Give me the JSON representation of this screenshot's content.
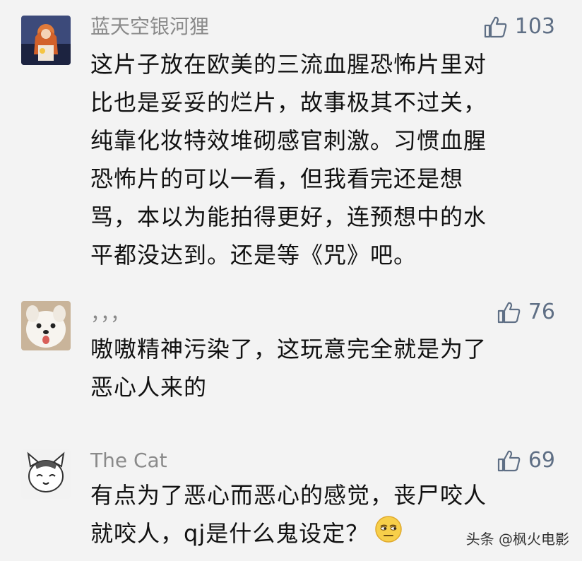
{
  "comments": [
    {
      "username": "蓝天空银河狸",
      "likes": "103",
      "lines": [
        "这片子放在欧美的三流血腥恐怖片里对",
        "比也是妥妥的烂片，故事极其不过关，",
        "纯靠化妆特效堆砌感官刺激。习惯血腥",
        "恐怖片的可以一看，但我看完还是想",
        "骂，本以为能拍得更好，连预想中的水",
        "平都没达到。还是等《咒》吧。"
      ]
    },
    {
      "username": "，，，",
      "likes": "76",
      "lines": [
        "嗷嗷精神污染了，这玩意完全就是为了",
        "恶心人来的"
      ]
    },
    {
      "username": "The Cat",
      "likes": "69",
      "lines": [
        "有点为了恶心而恶心的感觉，丧尸咬人",
        "就咬人，qj是什么鬼设定？"
      ]
    }
  ],
  "icons": {
    "like": "thumbs-up-icon",
    "emoji": "unamused-face-emoji"
  },
  "watermark": "头条 @枫火电影"
}
